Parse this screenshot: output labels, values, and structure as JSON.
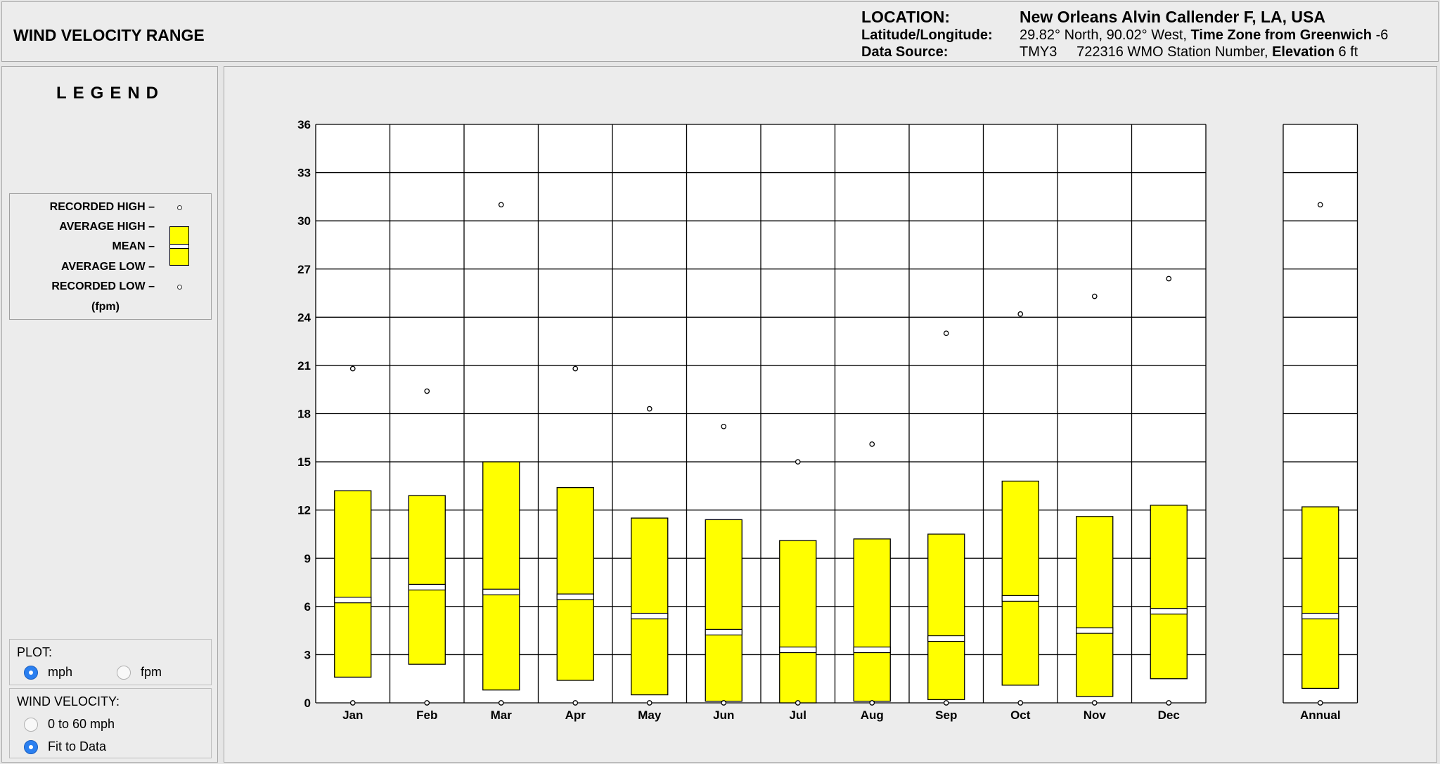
{
  "app": {
    "title": "WIND VELOCITY RANGE"
  },
  "header": {
    "location_label": "LOCATION:",
    "location_value": "New Orleans Alvin Callender F, LA, USA",
    "latlon_label": "Latitude/Longitude:",
    "latlon_value": "29.82° North, 90.02° West,",
    "timezone_label": "Time Zone from Greenwich",
    "timezone_value": "-6",
    "source_label": "Data Source:",
    "source_value": "TMY3",
    "station_value": "722316 WMO Station Number,",
    "elevation_label": "Elevation",
    "elevation_value": "6 ft"
  },
  "legend": {
    "title": "LEGEND",
    "recorded_high": "RECORDED HIGH –",
    "average_high": "AVERAGE HIGH –",
    "mean": "MEAN –",
    "average_low": "AVERAGE LOW –",
    "recorded_low": "RECORDED LOW –",
    "units": "(fpm)"
  },
  "controls": {
    "plot_title": "PLOT:",
    "plot_mph": "mph",
    "plot_fpm": "fpm",
    "plot_selected": "mph",
    "velocity_title": "WIND VELOCITY:",
    "range_fixed": "0 to 60 mph",
    "range_fit": "Fit to Data",
    "range_selected": "Fit to Data"
  },
  "colors": {
    "box_fill": "#ffff00",
    "mean_line": "#ffffff",
    "grid": "#000000",
    "plot_bg": "#ffffff"
  },
  "chart_data": {
    "type": "box",
    "categories": [
      "Jan",
      "Feb",
      "Mar",
      "Apr",
      "May",
      "Jun",
      "Jul",
      "Aug",
      "Sep",
      "Oct",
      "Nov",
      "Dec",
      "Annual"
    ],
    "ylim": [
      0,
      36
    ],
    "yticks": [
      0,
      3,
      6,
      9,
      12,
      15,
      18,
      21,
      24,
      27,
      30,
      33,
      36
    ],
    "recorded_high": [
      20.8,
      19.4,
      31.0,
      20.8,
      18.3,
      17.2,
      15.0,
      16.1,
      23.0,
      24.2,
      25.3,
      26.4,
      31.0
    ],
    "average_high": [
      13.2,
      12.9,
      15.0,
      13.4,
      11.5,
      11.4,
      10.1,
      10.2,
      10.5,
      13.8,
      11.6,
      12.3,
      12.2
    ],
    "mean": [
      6.4,
      7.2,
      6.9,
      6.6,
      5.4,
      4.4,
      3.3,
      3.3,
      4.0,
      6.5,
      4.5,
      5.7,
      5.4
    ],
    "average_low": [
      1.6,
      2.4,
      0.8,
      1.4,
      0.5,
      0.1,
      0.0,
      0.1,
      0.2,
      1.1,
      0.4,
      1.5,
      0.9
    ],
    "recorded_low": [
      0,
      0,
      0,
      0,
      0,
      0,
      0,
      0,
      0,
      0,
      0,
      0,
      0
    ],
    "grid": true
  }
}
